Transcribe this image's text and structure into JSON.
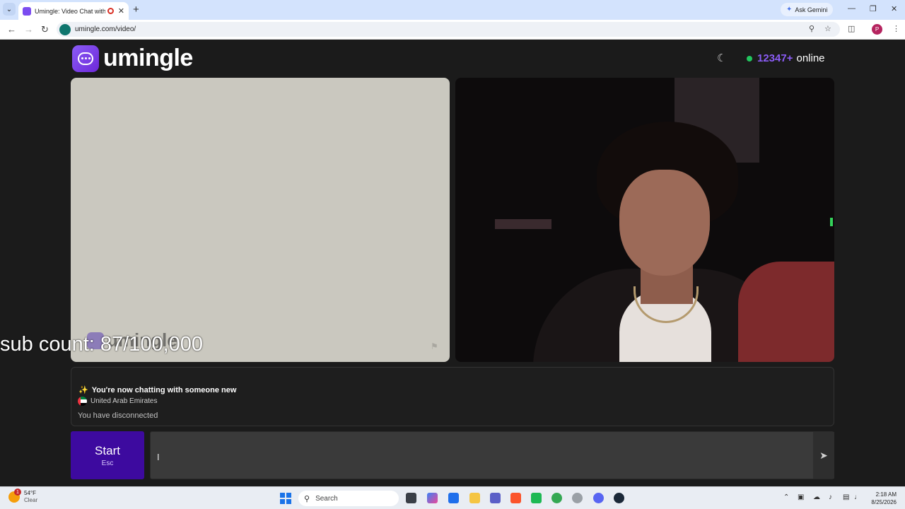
{
  "browser": {
    "tab_title": "Umingle: Video Chat with St",
    "new_tab": "+",
    "gemini": "Ask Gemini",
    "url": "umingle.com/video/",
    "profile_initial": "P"
  },
  "site": {
    "logo_text": "umingle",
    "online_count": "12347+",
    "online_label": "online",
    "ghost_logo_text": "umingle"
  },
  "overlay": {
    "stream_text": "sub count: 87/100,000"
  },
  "chat": {
    "new_partner": "You're now chatting with someone new",
    "country": "United Arab Emirates",
    "status": "You have disconnected"
  },
  "controls": {
    "start_label": "Start",
    "start_key": "Esc",
    "message_value": ""
  },
  "taskbar": {
    "weather_badge": "1",
    "temperature": "54°F",
    "weather_desc": "Clear",
    "search_label": "Search",
    "time": "2:18 AM",
    "date": "8/25/2026"
  },
  "icons": {
    "send": "paper-plane-icon",
    "theme": "moon-icon",
    "report": "flag-icon"
  },
  "colors": {
    "brand_purple": "#8b5cf6",
    "start_button": "#3d0a9f",
    "online_dot": "#22c55e"
  }
}
